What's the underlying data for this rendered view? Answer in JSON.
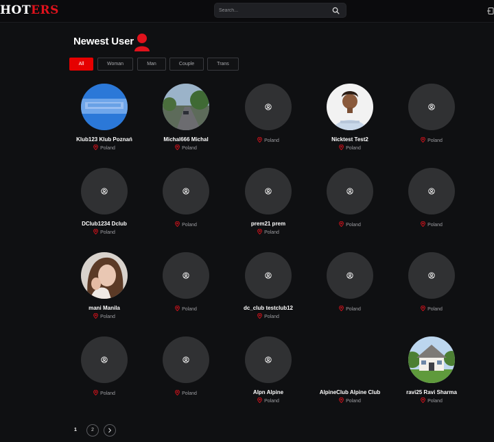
{
  "header": {
    "logo_white": "HOT",
    "logo_red": "ERS",
    "search_placeholder": "Search..."
  },
  "section": {
    "title": "Newest User"
  },
  "filters": [
    {
      "label": "All",
      "active": true
    },
    {
      "label": "Woman",
      "active": false
    },
    {
      "label": "Man",
      "active": false
    },
    {
      "label": "Couple",
      "active": false
    },
    {
      "label": "Trans",
      "active": false
    }
  ],
  "users": [
    {
      "name": "Klub123 Klub Poznań",
      "location": "Poland",
      "avatar": "blue"
    },
    {
      "name": "Michal666 Michal",
      "location": "Poland",
      "avatar": "street"
    },
    {
      "name": "",
      "location": "Poland",
      "avatar": "placeholder"
    },
    {
      "name": "Nicktest Test2",
      "location": "Poland",
      "avatar": "man"
    },
    {
      "name": "",
      "location": "Poland",
      "avatar": "placeholder"
    },
    {
      "name": "DClub1234 Dclub",
      "location": "Poland",
      "avatar": "placeholder"
    },
    {
      "name": "",
      "location": "Poland",
      "avatar": "placeholder"
    },
    {
      "name": "prem21 prem",
      "location": "Poland",
      "avatar": "placeholder"
    },
    {
      "name": "",
      "location": "Poland",
      "avatar": "placeholder"
    },
    {
      "name": "",
      "location": "Poland",
      "avatar": "placeholder"
    },
    {
      "name": "mani Manila",
      "location": "Poland",
      "avatar": "woman"
    },
    {
      "name": "",
      "location": "Poland",
      "avatar": "placeholder"
    },
    {
      "name": "dc_club testclub12",
      "location": "Poland",
      "avatar": "placeholder"
    },
    {
      "name": "",
      "location": "Poland",
      "avatar": "placeholder"
    },
    {
      "name": "",
      "location": "Poland",
      "avatar": "placeholder"
    },
    {
      "name": "",
      "location": "Poland",
      "avatar": "placeholder"
    },
    {
      "name": "",
      "location": "Poland",
      "avatar": "placeholder"
    },
    {
      "name": "Alpn Alpine",
      "location": "Poland",
      "avatar": "placeholder"
    },
    {
      "name": "AlpineClub Alpine Club",
      "location": "Poland",
      "avatar": "none"
    },
    {
      "name": "ravi25 Ravi Sharma",
      "location": "Poland",
      "avatar": "house"
    }
  ],
  "pagination": {
    "pages": [
      "1",
      "2"
    ],
    "current": "1",
    "next_icon": "chevron-right-icon"
  },
  "colors": {
    "accent": "#e60000",
    "background": "#0f1012",
    "placeholder_avatar": "#303133"
  }
}
